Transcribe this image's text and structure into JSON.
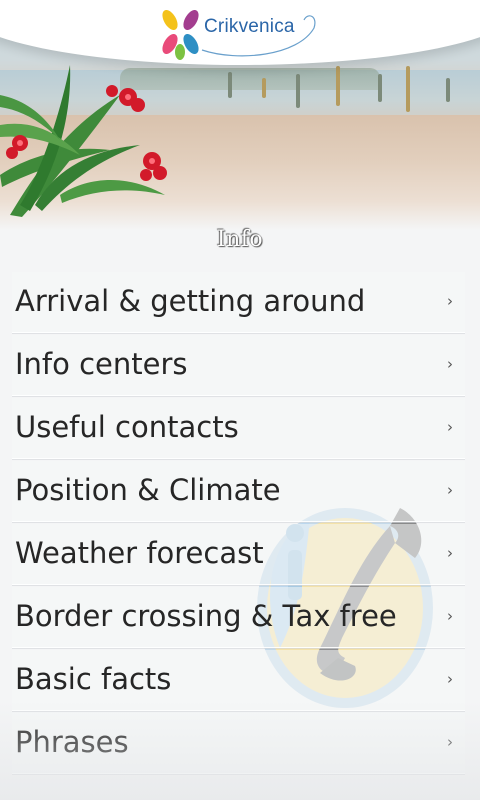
{
  "header": {
    "logo_text": "Crikvenica",
    "brand_colors": [
      "#f4c21b",
      "#a33d8f",
      "#2e8fc4",
      "#7cc242",
      "#e94b7a"
    ]
  },
  "section": {
    "title": "Info"
  },
  "menu": {
    "items": [
      {
        "label": "Arrival & getting around",
        "icon": "chevron-right-icon"
      },
      {
        "label": "Info centers",
        "icon": "chevron-right-icon"
      },
      {
        "label": "Useful contacts",
        "icon": "chevron-right-icon"
      },
      {
        "label": "Position & Climate",
        "icon": "chevron-right-icon"
      },
      {
        "label": "Weather forecast",
        "icon": "chevron-right-icon"
      },
      {
        "label": "Border crossing & Tax free",
        "icon": "chevron-right-icon"
      },
      {
        "label": "Basic facts",
        "icon": "chevron-right-icon"
      },
      {
        "label": "Phrases",
        "icon": "chevron-right-icon"
      }
    ],
    "chevron_glyph": "›"
  },
  "watermark": {
    "icon": "info-phone-icon"
  }
}
